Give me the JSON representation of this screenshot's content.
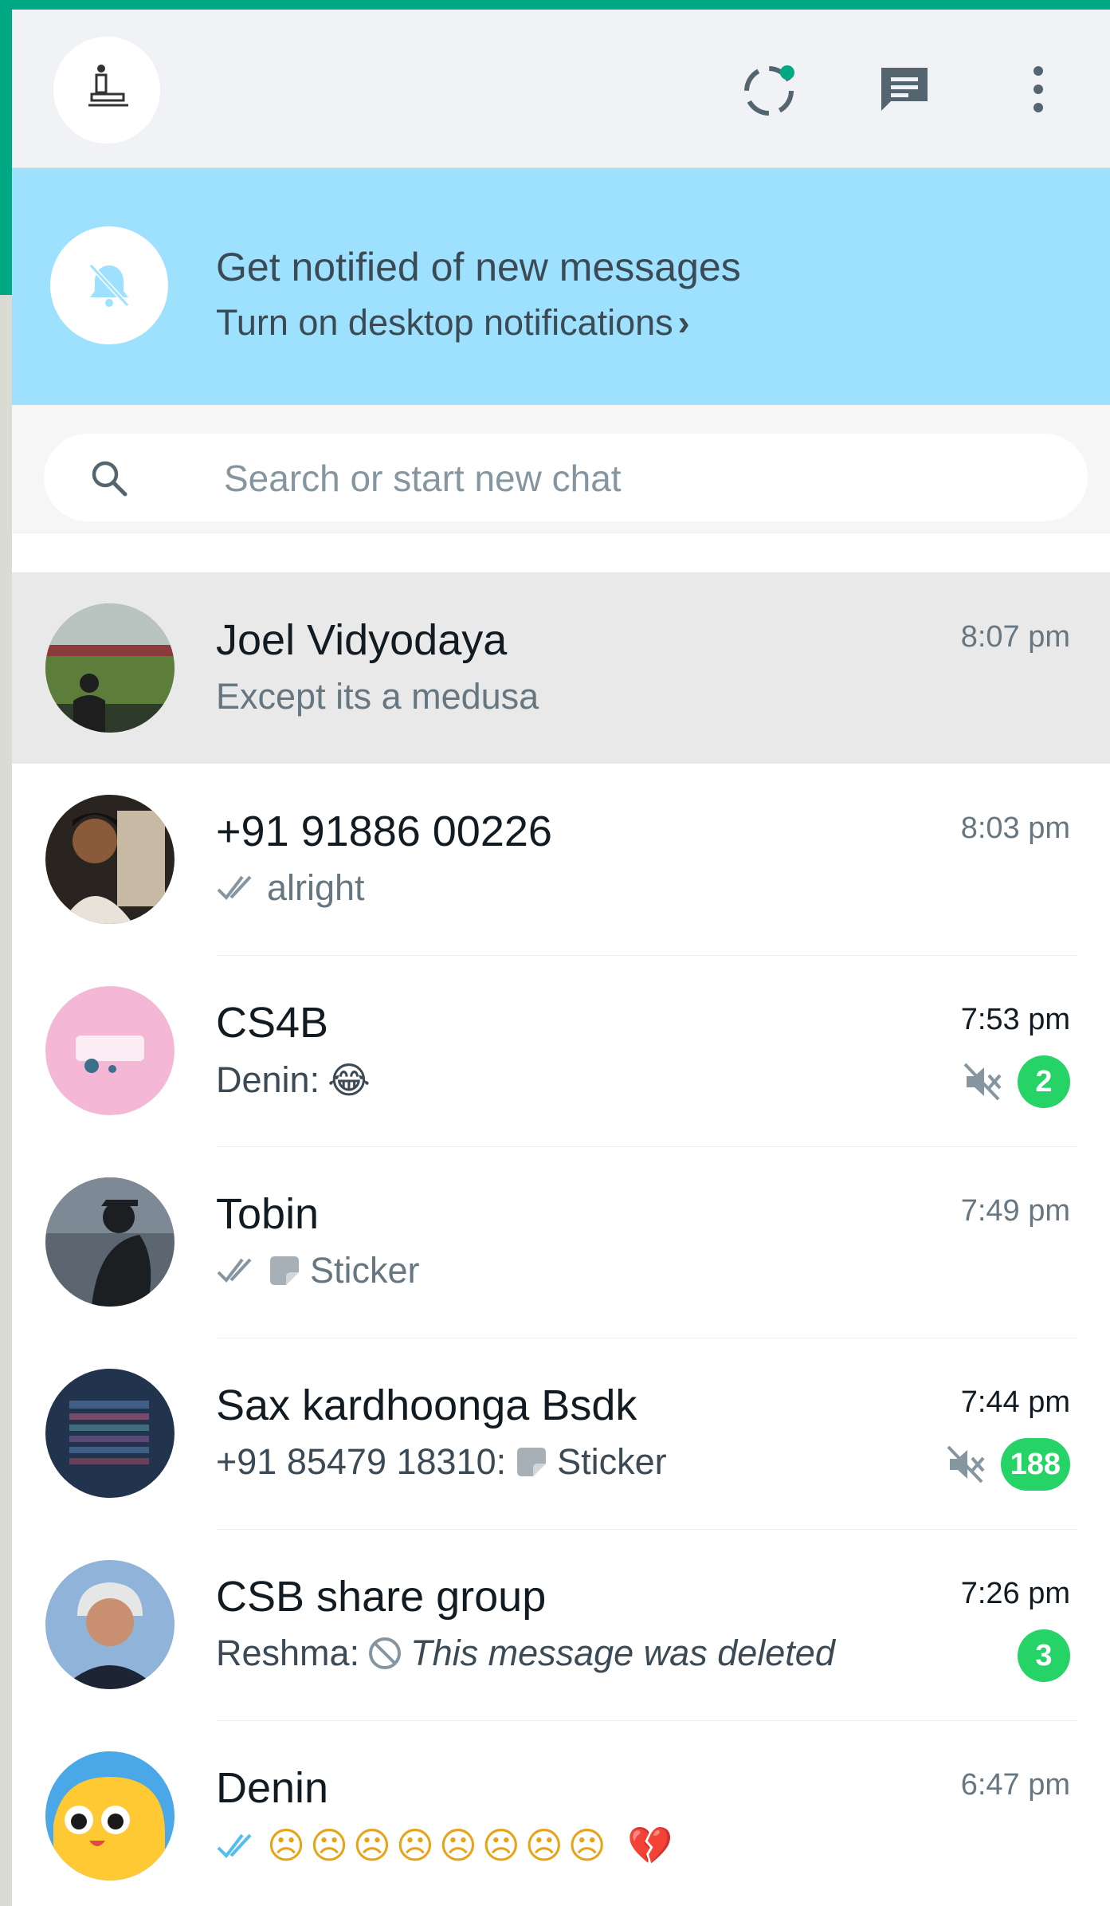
{
  "header": {
    "avatar_icon": "user-avatar",
    "status_icon": "status-icon",
    "new_chat_icon": "new-chat-icon",
    "menu_icon": "menu-icon"
  },
  "banner": {
    "icon": "bell-off-icon",
    "title": "Get notified of new messages",
    "subtitle": "Turn on desktop notifications",
    "chevron": "›"
  },
  "search": {
    "placeholder": "Search or start new chat"
  },
  "chats": [
    {
      "name": "Joel Vidyodaya",
      "time": "8:07 pm",
      "preview": "Except its a medusa",
      "active": true
    },
    {
      "name": "+91 91886 00226",
      "time": "8:03 pm",
      "preview": "alright",
      "ticks": "read-grey"
    },
    {
      "name": "CS4B",
      "time": "7:53 pm",
      "preview_sender": "Denin:",
      "preview_emoji": "😂",
      "muted": true,
      "unread": "2"
    },
    {
      "name": "Tobin",
      "time": "7:49 pm",
      "preview": "Sticker",
      "ticks": "read-grey",
      "sticker": true
    },
    {
      "name": "Sax kardhoonga Bsdk",
      "time": "7:44 pm",
      "preview_sender": "+91 85479 18310:",
      "preview": "Sticker",
      "sticker": true,
      "muted": true,
      "unread": "188"
    },
    {
      "name": "CSB share group",
      "time": "7:26 pm",
      "preview_sender": "Reshma:",
      "preview": "This message was deleted",
      "deleted": true,
      "unread": "3"
    },
    {
      "name": "Denin",
      "time": "6:47 pm",
      "preview_emoji": "☹☹☹☹☹☹☹☹ 💔",
      "ticks": "read-blue"
    }
  ],
  "colors": {
    "accent": "#00a884",
    "banner": "#9de1fe",
    "badge": "#25d366",
    "read_tick": "#53bdeb"
  }
}
